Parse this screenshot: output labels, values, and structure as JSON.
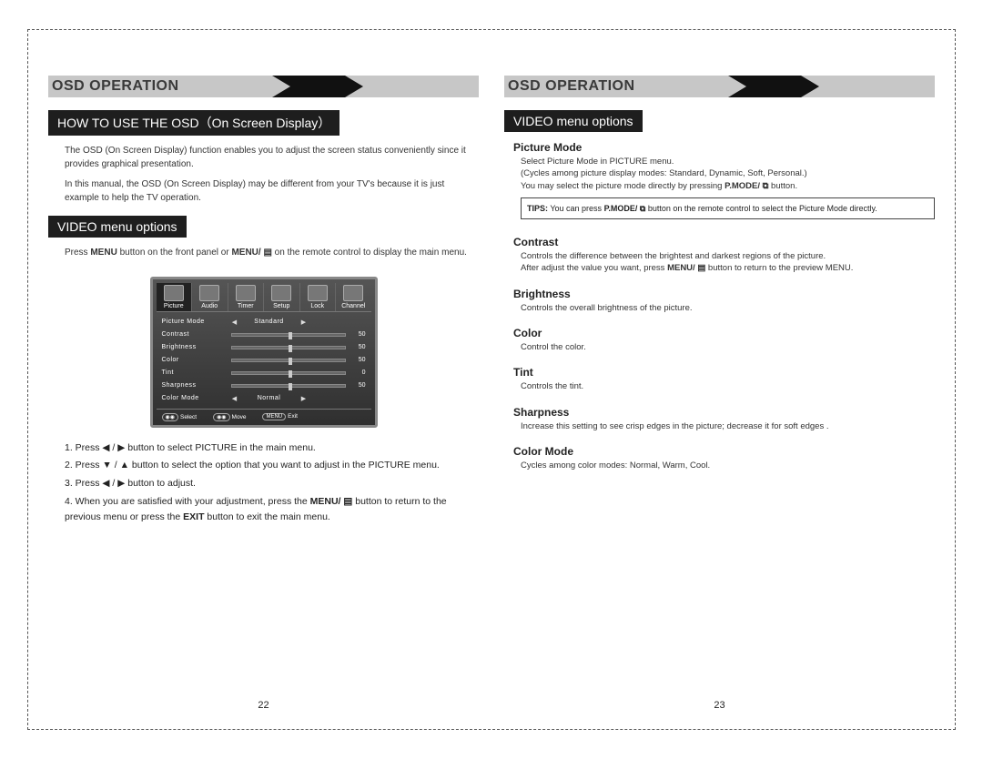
{
  "left": {
    "banner": "OSD OPERATION",
    "sub1": "HOW TO USE THE OSD（On Screen Display）",
    "intro1": "The OSD (On Screen Display) function enables you to adjust the screen status conveniently since it provides graphical presentation.",
    "intro2_a": "In this manual, the OSD (On Screen Display) may be different from your TV's because it is just example to help the TV operation.",
    "sub2": "VIDEO menu options",
    "press_a": "Press ",
    "press_menu": "MENU",
    "press_b": " button on the front panel or ",
    "press_menu2": "MENU/ ▤",
    "press_c": " on the remote control to display the main menu.",
    "osd": {
      "tabs": [
        "Picture",
        "Audio",
        "Timer",
        "Setup",
        "Lock",
        "Channel"
      ],
      "modeRow": {
        "label": "Picture Mode",
        "value": "Standard"
      },
      "sliders": [
        {
          "label": "Contrast",
          "value": 50,
          "pct": 50
        },
        {
          "label": "Brightness",
          "value": 50,
          "pct": 50
        },
        {
          "label": "Color",
          "value": 50,
          "pct": 50
        },
        {
          "label": "Tint",
          "value": 0,
          "pct": 50
        },
        {
          "label": "Sharpness",
          "value": 50,
          "pct": 50
        }
      ],
      "colorRow": {
        "label": "Color Mode",
        "value": "Normal"
      },
      "foot": {
        "select": "Select",
        "move": "Move",
        "exit": "Exit",
        "exitBtn": "MENU"
      }
    },
    "steps": {
      "s1a": "1. Press ◀ / ▶ button to select PICTURE in the main menu.",
      "s2a": "2. Press ▼ / ▲ button to select the option that you want to adjust in the PICTURE menu.",
      "s3a": "3. Press ◀ / ▶ button to adjust.",
      "s4a": "4. When you are satisfied with your adjustment, press the ",
      "s4b": "MENU/ ▤",
      "s4c": " button to return to the previous menu or press the ",
      "s4d": "EXIT",
      "s4e": " button to exit the main menu."
    },
    "page": "22"
  },
  "right": {
    "banner": "OSD OPERATION",
    "sub": "VIDEO menu options",
    "picmode": {
      "h": "Picture Mode",
      "l1": "Select Picture Mode in PICTURE menu.",
      "l2": "(Cycles among picture display modes: Standard, Dynamic, Soft, Personal.)",
      "l3a": "You may select the picture mode directly by pressing ",
      "l3b": "P.MODE/ ⧉",
      "l3c": " button.",
      "tip_a": "TIPS:",
      "tip_b": " You can press ",
      "tip_c": "P.MODE/ ⧉",
      "tip_d": " button on the remote control to select the Picture Mode directly."
    },
    "contrast": {
      "h": "Contrast",
      "l1": "Controls the difference between the brightest and darkest regions of the picture.",
      "l2a": "After adjust the value you want, press ",
      "l2b": "MENU/ ▤",
      "l2c": " button to return to the preview MENU."
    },
    "brightness": {
      "h": "Brightness",
      "l": "Controls the overall brightness of the picture."
    },
    "color": {
      "h": "Color",
      "l": "Control the color."
    },
    "tint": {
      "h": "Tint",
      "l": "Controls the tint."
    },
    "sharp": {
      "h": "Sharpness",
      "l": "Increase this setting to see crisp edges in the picture; decrease it for soft edges ."
    },
    "cmode": {
      "h": "Color Mode",
      "l": "Cycles among color modes: Normal, Warm, Cool."
    },
    "page": "23"
  }
}
